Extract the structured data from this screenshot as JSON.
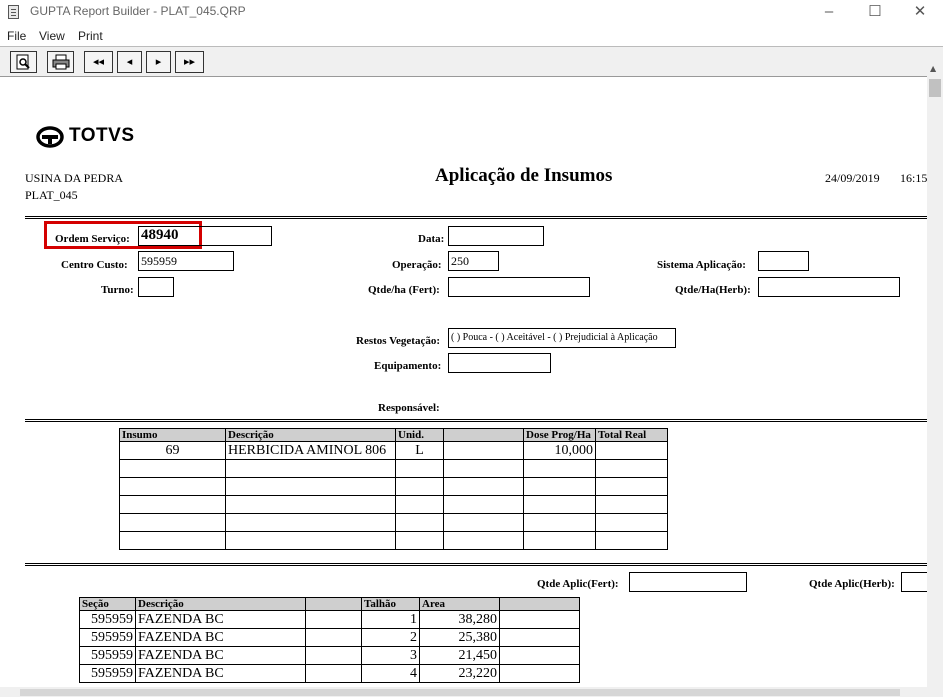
{
  "window": {
    "title": "GUPTA Report Builder - PLAT_045.QRP"
  },
  "menu": [
    "File",
    "View",
    "Print"
  ],
  "toolbar": {
    "preview": "preview-icon",
    "print": "printer-icon",
    "first": "◂◂",
    "prev": "◂",
    "next": "▸",
    "last": "▸▸"
  },
  "report": {
    "logo": "TOTVS",
    "company": "USINA DA PEDRA",
    "report_code": "PLAT_045",
    "title": "Aplicação de Insumos",
    "date": "24/09/2019",
    "time": "16:15",
    "fields": {
      "ordem_servico_label": "Ordem Serviço:",
      "ordem_servico_value": "48940",
      "data_label": "Data:",
      "data_value": "",
      "centro_custo_label": "Centro Custo:",
      "centro_custo_value": "595959",
      "operacao_label": "Operação:",
      "operacao_value": "250",
      "sistema_aplicacao_label": "Sistema Aplicação:",
      "sistema_aplicacao_value": "",
      "turno_label": "Turno:",
      "turno_value": "",
      "qtde_fert_label": "Qtde/ha (Fert):",
      "qtde_fert_value": "",
      "qtde_herb_label": "Qtde/Ha(Herb):",
      "qtde_herb_value": "",
      "restos_label": "Restos Vegetação:",
      "restos_value": "( ) Pouca - ( ) Aceitável - ( ) Prejudicial à Aplicação",
      "equipamento_label": "Equipamento:",
      "equipamento_value": "",
      "responsavel_label": "Responsável:"
    },
    "insumos": {
      "headers": [
        "Insumo",
        "Descrição",
        "Unid.",
        "",
        "Dose Prog/Ha",
        "Total Real"
      ],
      "rows": [
        [
          "69",
          "HERBICIDA AMINOL 806",
          "L",
          "",
          "10,000",
          ""
        ]
      ],
      "empty_rows": 5
    },
    "aplic": {
      "fert_label": "Qtde Aplic(Fert):",
      "herb_label": "Qtde Aplic(Herb):"
    },
    "secoes": {
      "headers": [
        "Seção",
        "Descrição",
        "",
        "Talhão",
        "Area",
        ""
      ],
      "rows": [
        [
          "595959",
          "FAZENDA BC",
          "",
          "1",
          "38,280",
          ""
        ],
        [
          "595959",
          "FAZENDA BC",
          "",
          "2",
          "25,380",
          ""
        ],
        [
          "595959",
          "FAZENDA BC",
          "",
          "3",
          "21,450",
          ""
        ],
        [
          "595959",
          "FAZENDA BC",
          "",
          "4",
          "23,220",
          ""
        ]
      ]
    },
    "highlight_color": "#d40000"
  }
}
